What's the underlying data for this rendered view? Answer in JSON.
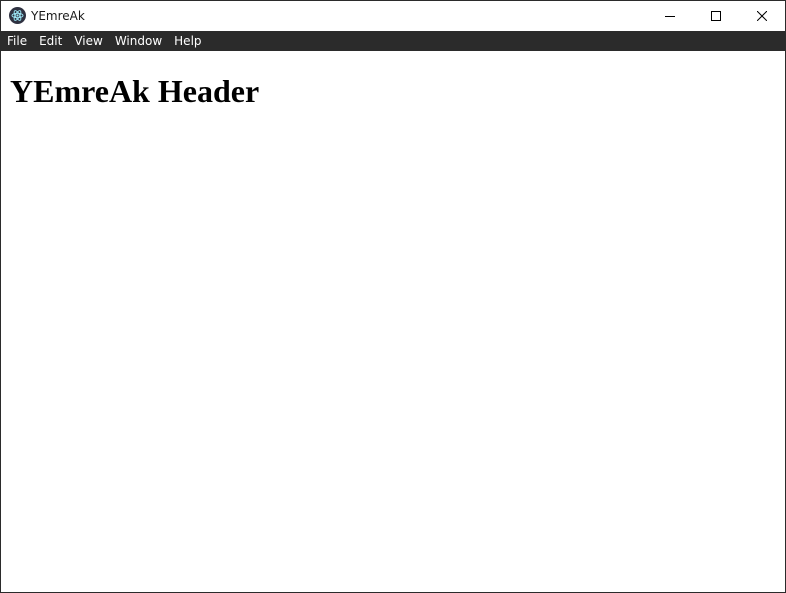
{
  "window": {
    "title": "YEmreAk"
  },
  "menu": {
    "items": [
      {
        "label": "File"
      },
      {
        "label": "Edit"
      },
      {
        "label": "View"
      },
      {
        "label": "Window"
      },
      {
        "label": "Help"
      }
    ]
  },
  "content": {
    "header": "YEmreAk Header"
  },
  "colors": {
    "menubar_bg": "#2b2b2b",
    "menubar_text": "#ffffff",
    "window_border": "#2b2b2b"
  }
}
